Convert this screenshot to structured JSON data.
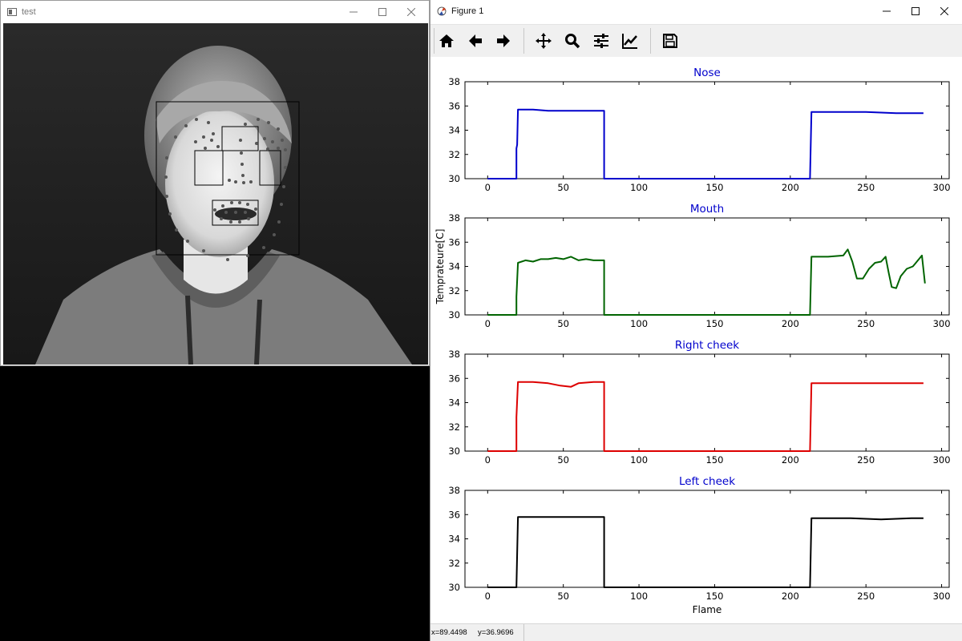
{
  "left_window": {
    "title": "test",
    "minimize_icon": "minimize-icon",
    "maximize_icon": "maximize-icon",
    "close_icon": "close-icon"
  },
  "figure_window": {
    "title": "Figure 1",
    "toolbar": [
      "home-icon",
      "back-arrow-icon",
      "forward-arrow-icon",
      "pan-icon",
      "zoom-icon",
      "configure-subplots-icon",
      "edit-axis-icon",
      "save-icon"
    ],
    "status": {
      "x": "x=89.4498",
      "y": "y=36.9696"
    }
  },
  "colors": {
    "title_text": "#0000cc",
    "nose": "#0000cc",
    "mouth": "#006400",
    "right_cheek": "#dd0000",
    "left_cheek": "#000000"
  },
  "chart_data": [
    {
      "type": "line",
      "title": "Nose",
      "xlim": [
        -15,
        305
      ],
      "ylim": [
        30,
        38
      ],
      "xticks": [
        0,
        50,
        100,
        150,
        200,
        250,
        300
      ],
      "yticks": [
        30,
        32,
        34,
        36,
        38
      ],
      "series": [
        {
          "color": "#0000cc",
          "points": [
            [
              0,
              30
            ],
            [
              19,
              30
            ],
            [
              19,
              32.5
            ],
            [
              19.5,
              32.8
            ],
            [
              20,
              35.7
            ],
            [
              30,
              35.7
            ],
            [
              40,
              35.6
            ],
            [
              50,
              35.6
            ],
            [
              60,
              35.6
            ],
            [
              70,
              35.6
            ],
            [
              77,
              35.6
            ],
            [
              77,
              30
            ],
            [
              213,
              30
            ],
            [
              214,
              35.5
            ],
            [
              230,
              35.5
            ],
            [
              250,
              35.5
            ],
            [
              270,
              35.4
            ],
            [
              280,
              35.4
            ],
            [
              288,
              35.4
            ]
          ]
        }
      ]
    },
    {
      "type": "line",
      "title": "Mouth",
      "ylabel": "Temprateure[C]",
      "xlim": [
        -15,
        305
      ],
      "ylim": [
        30,
        38
      ],
      "xticks": [
        0,
        50,
        100,
        150,
        200,
        250,
        300
      ],
      "yticks": [
        30,
        32,
        34,
        36,
        38
      ],
      "series": [
        {
          "color": "#006400",
          "points": [
            [
              0,
              30
            ],
            [
              19,
              30
            ],
            [
              19,
              31.5
            ],
            [
              20,
              34.3
            ],
            [
              25,
              34.5
            ],
            [
              30,
              34.4
            ],
            [
              35,
              34.6
            ],
            [
              40,
              34.6
            ],
            [
              45,
              34.7
            ],
            [
              50,
              34.6
            ],
            [
              55,
              34.8
            ],
            [
              60,
              34.5
            ],
            [
              65,
              34.6
            ],
            [
              70,
              34.5
            ],
            [
              77,
              34.5
            ],
            [
              77,
              30
            ],
            [
              213,
              30
            ],
            [
              214,
              34.8
            ],
            [
              225,
              34.8
            ],
            [
              235,
              34.9
            ],
            [
              238,
              35.4
            ],
            [
              241,
              34.4
            ],
            [
              244,
              33.0
            ],
            [
              248,
              33.0
            ],
            [
              252,
              33.8
            ],
            [
              256,
              34.3
            ],
            [
              260,
              34.4
            ],
            [
              263,
              34.8
            ],
            [
              265,
              33.5
            ],
            [
              267,
              32.3
            ],
            [
              270,
              32.2
            ],
            [
              273,
              33.2
            ],
            [
              277,
              33.8
            ],
            [
              281,
              34.0
            ],
            [
              285,
              34.6
            ],
            [
              287,
              34.9
            ],
            [
              289,
              32.6
            ]
          ]
        }
      ]
    },
    {
      "type": "line",
      "title": "Right cheek",
      "xlim": [
        -15,
        305
      ],
      "ylim": [
        30,
        38
      ],
      "xticks": [
        0,
        50,
        100,
        150,
        200,
        250,
        300
      ],
      "yticks": [
        30,
        32,
        34,
        36,
        38
      ],
      "series": [
        {
          "color": "#dd0000",
          "points": [
            [
              0,
              30
            ],
            [
              19,
              30
            ],
            [
              19,
              32.8
            ],
            [
              20,
              35.7
            ],
            [
              30,
              35.7
            ],
            [
              40,
              35.6
            ],
            [
              48,
              35.4
            ],
            [
              55,
              35.3
            ],
            [
              60,
              35.6
            ],
            [
              70,
              35.7
            ],
            [
              77,
              35.7
            ],
            [
              77,
              30
            ],
            [
              213,
              30
            ],
            [
              214,
              35.6
            ],
            [
              230,
              35.6
            ],
            [
              250,
              35.6
            ],
            [
              270,
              35.6
            ],
            [
              288,
              35.6
            ]
          ]
        }
      ]
    },
    {
      "type": "line",
      "title": "Left cheek",
      "xlabel": "Flame",
      "xlim": [
        -15,
        305
      ],
      "ylim": [
        30,
        38
      ],
      "xticks": [
        0,
        50,
        100,
        150,
        200,
        250,
        300
      ],
      "yticks": [
        30,
        32,
        34,
        36,
        38
      ],
      "series": [
        {
          "color": "#000000",
          "points": [
            [
              0,
              30
            ],
            [
              19,
              30
            ],
            [
              20,
              35.8
            ],
            [
              40,
              35.8
            ],
            [
              60,
              35.8
            ],
            [
              77,
              35.8
            ],
            [
              77,
              30
            ],
            [
              213,
              30
            ],
            [
              214,
              35.7
            ],
            [
              240,
              35.7
            ],
            [
              260,
              35.6
            ],
            [
              280,
              35.7
            ],
            [
              288,
              35.7
            ]
          ]
        }
      ]
    }
  ]
}
